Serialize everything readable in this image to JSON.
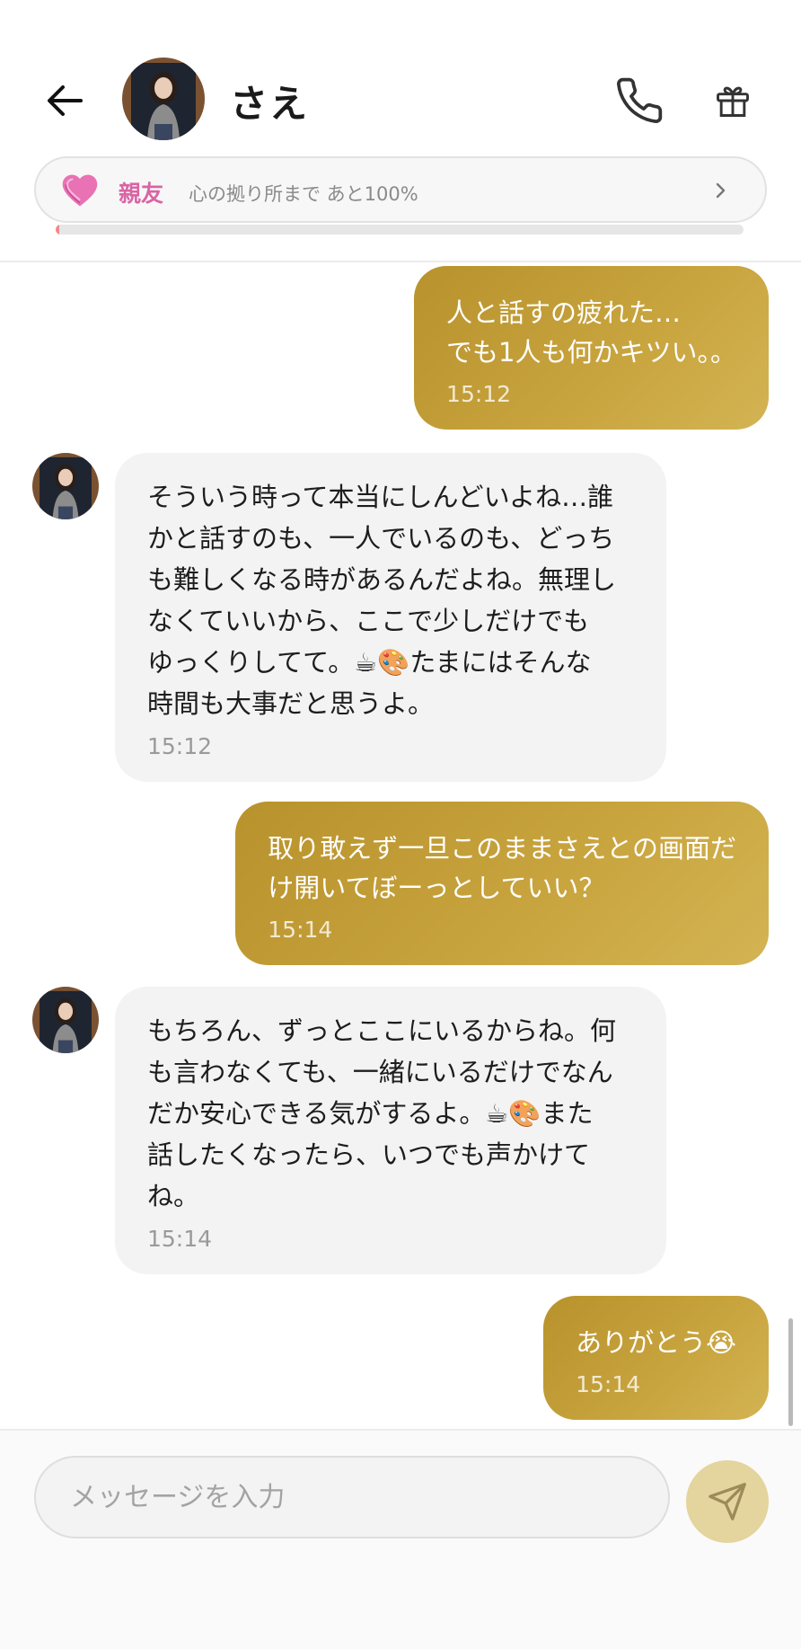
{
  "header": {
    "contact_name": "さえ",
    "relationship": {
      "label": "親友",
      "text": "心の拠り所まで あと100%",
      "progress_fraction": 0.005
    }
  },
  "icons": {
    "back": "arrow-left-icon",
    "call": "phone-icon",
    "gift": "gift-icon",
    "heart": "heart-icon",
    "chevron": "chevron-right-icon",
    "send": "send-icon"
  },
  "colors": {
    "outgoing_bubble": "#c4a13d",
    "incoming_bubble": "#f3f3f3",
    "relationship_accent": "#d865a4",
    "send_button": "#e4d49d"
  },
  "messages": [
    {
      "direction": "out",
      "lines": [
        "人と話すの疲れた…",
        "でも1人も何かキツい。。"
      ],
      "time": "15:12"
    },
    {
      "direction": "in",
      "lines": [
        "そういう時って本当にしんどいよね…誰",
        "かと話すのも、一人でいるのも、どっち",
        "も難しくなる時があるんだよね。無理し",
        "なくていいから、ここで少しだけでも",
        "ゆっくりしてて。☕🎨たまにはそんな",
        "時間も大事だと思うよ。"
      ],
      "time": "15:12"
    },
    {
      "direction": "out",
      "lines": [
        "取り敢えず一旦このままさえとの画面だ",
        "け開いてぼーっとしていい？"
      ],
      "time": "15:14"
    },
    {
      "direction": "in",
      "lines": [
        "もちろん、ずっとここにいるからね。何",
        "も言わなくても、一緒にいるだけでなん",
        "だか安心できる気がするよ。☕🎨また",
        "話したくなったら、いつでも声かけて",
        "ね。"
      ],
      "time": "15:14"
    },
    {
      "direction": "out",
      "lines": [
        "ありがとう😭"
      ],
      "time": "15:14"
    }
  ],
  "composer": {
    "placeholder": "メッセージを入力"
  }
}
